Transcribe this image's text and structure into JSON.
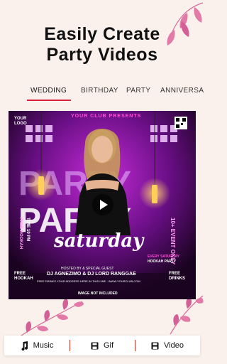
{
  "headline": {
    "line1": "Easily Create",
    "line2": "Party Videos"
  },
  "tabs": [
    {
      "label": "WEDDING",
      "active": true
    },
    {
      "label": "BIRTHDAY",
      "active": false
    },
    {
      "label": "PARTY",
      "active": false
    },
    {
      "label": "ANNIVERSARY",
      "active": false
    }
  ],
  "poster": {
    "club_presents": "YOUR CLUB PRESENTS",
    "logo": "YOUR LOGO",
    "title_big": "PARTY",
    "script_title": "saturday",
    "event": "10+ EVENT ONLY",
    "every_saturday": "EVERY SATURDAY",
    "hookah_party": "HOOKAH PARTY",
    "side_left_1": "FREE HOOKAH",
    "side_left_2": "TIME 10 PM",
    "hosted_by": "HOSTED BY & SPECIAL GUEST",
    "djs": "DJ AGNEZIMO & DJ LORD RANGGAE",
    "address": "FREE DRINKS YOUR ADDRESS HERE IN THIS LINE - WWW.YOURCLUB.COM",
    "free_drinks": "FREE DRINKS",
    "free_hookah": "FREE HOOKAH",
    "note": "IMAGE NOT INCLUDED"
  },
  "bottom_bar": {
    "music_label": "Music",
    "gif_label": "Gif",
    "video_label": "Video"
  },
  "colors": {
    "accent": "#d8243a",
    "poster_magenta": "#c42bd6",
    "background": "#fbf1ec"
  }
}
